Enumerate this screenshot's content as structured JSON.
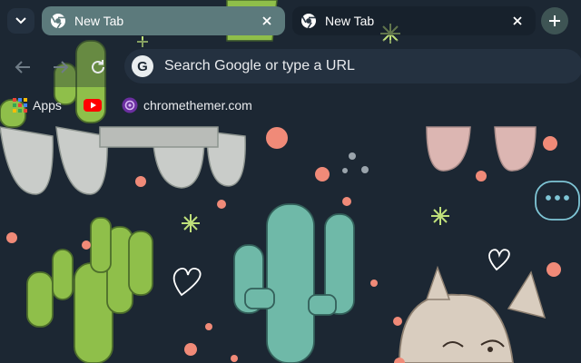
{
  "tabs": [
    {
      "title": "New Tab",
      "active": true,
      "favicon": "chrome-icon"
    },
    {
      "title": "New Tab",
      "active": false,
      "favicon": "chrome-icon"
    }
  ],
  "omnibox": {
    "placeholder": "Search Google or type a URL",
    "search_icon": "google-g-icon"
  },
  "bookmarks": [
    {
      "label": "Apps",
      "icon": "apps-grid-icon"
    },
    {
      "label": "",
      "icon": "youtube-icon"
    },
    {
      "label": "chromethemer.com",
      "icon": "chromethemer-icon"
    }
  ],
  "theme": {
    "background": "#1c2733",
    "active_tab": "#5c7a7c",
    "cactus_green": "#8fbf4a",
    "cactus_teal": "#6fb9a8",
    "dot_pink": "#f08a78"
  }
}
